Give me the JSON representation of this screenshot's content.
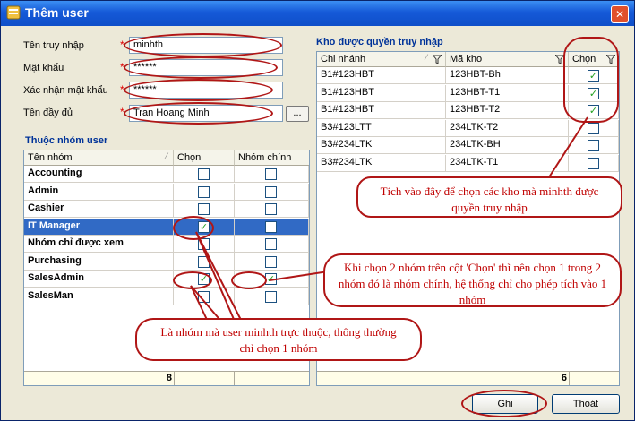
{
  "window": {
    "title": "Thêm user",
    "close_glyph": "✕"
  },
  "form": {
    "username_label": "Tên truy nhập",
    "username_value": "minhth",
    "password_label": "Mật khẩu",
    "password_value": "******",
    "confirm_label": "Xác nhận mật khẩu",
    "confirm_value": "******",
    "fullname_label": "Tên đầy đủ",
    "fullname_value": "Tran Hoang Minh",
    "browse_label": "...",
    "required_mark": "*"
  },
  "groups": {
    "section_title": "Thuộc nhóm user",
    "headers": {
      "name": "Tên nhóm",
      "choose": "Chọn",
      "primary": "Nhóm chính"
    },
    "rows": [
      {
        "name": "Accounting",
        "choose": false,
        "primary": false,
        "selected": false
      },
      {
        "name": "Admin",
        "choose": false,
        "primary": false,
        "selected": false
      },
      {
        "name": "Cashier",
        "choose": false,
        "primary": false,
        "selected": false
      },
      {
        "name": "IT Manager",
        "choose": true,
        "primary": false,
        "selected": true
      },
      {
        "name": "Nhóm chỉ được xem",
        "choose": false,
        "primary": false,
        "selected": false
      },
      {
        "name": "Purchasing",
        "choose": false,
        "primary": false,
        "selected": false
      },
      {
        "name": "SalesAdmin",
        "choose": true,
        "primary": true,
        "selected": false
      },
      {
        "name": "SalesMan",
        "choose": false,
        "primary": false,
        "selected": false
      }
    ],
    "count": "8"
  },
  "warehouses": {
    "section_title": "Kho được quyền truy nhập",
    "headers": {
      "branch": "Chi nhánh",
      "code": "Mã kho",
      "choose": "Chọn"
    },
    "rows": [
      {
        "branch": "B1#123HBT",
        "code": "123HBT-Bh",
        "choose": true
      },
      {
        "branch": "B1#123HBT",
        "code": "123HBT-T1",
        "choose": true
      },
      {
        "branch": "B1#123HBT",
        "code": "123HBT-T2",
        "choose": true
      },
      {
        "branch": "B3#123LTT",
        "code": "234LTK-T2",
        "choose": false
      },
      {
        "branch": "B3#234LTK",
        "code": "234LTK-BH",
        "choose": false
      },
      {
        "branch": "B3#234LTK",
        "code": "234LTK-T1",
        "choose": false
      }
    ],
    "count": "6"
  },
  "buttons": {
    "save": "Ghi",
    "exit": "Thoát"
  },
  "callouts": {
    "warehouse_note": "Tích vào đây để chọn các kho mà minhth được quyền truy nhập",
    "primary_note": "Khi chọn 2 nhóm trên cột 'Chọn' thì nên chọn 1 trong 2 nhóm đó là nhóm chính, hệ thống chỉ cho phép tích vào 1 nhóm",
    "group_note": "Là nhóm mà user minhth trực thuộc, thông thường chỉ chọn 1 nhóm"
  },
  "colors": {
    "title_bar": "#1559d8",
    "selection": "#316ac5",
    "annotation": "#b01616",
    "check": "#21a121"
  }
}
